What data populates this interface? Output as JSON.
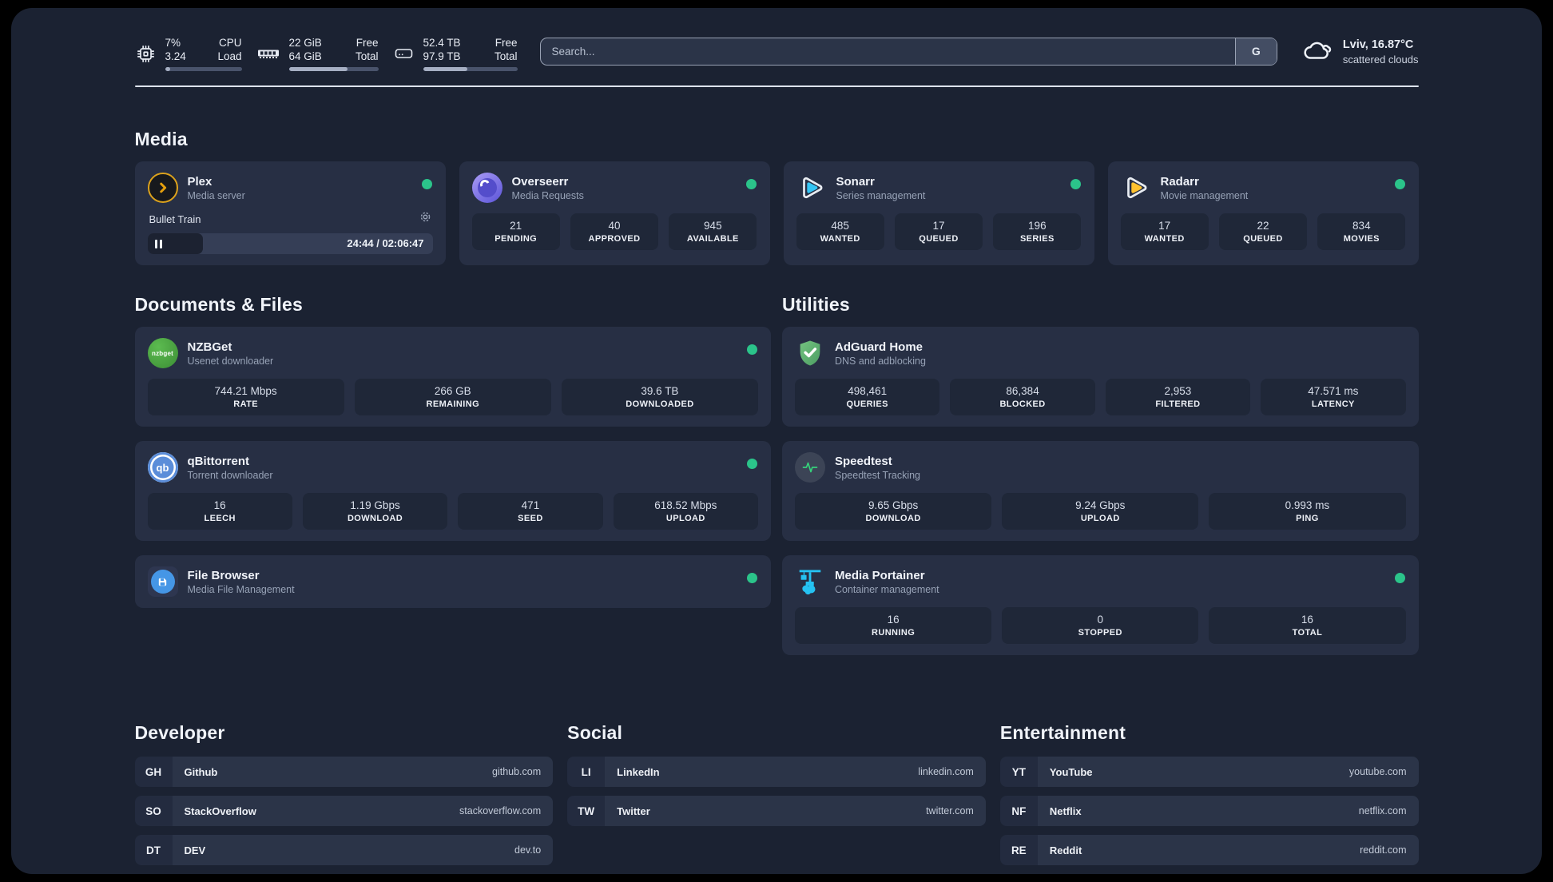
{
  "colors": {
    "status_online": "#2bc48a",
    "plex_gold": "#e5a00d",
    "overseerr_purple": "#6d64e8",
    "sonarr_cyan": "#35c5f4",
    "radarr_amber": "#ffc230",
    "nzbget_green": "#43a047",
    "qbittorrent_blue": "#5b8dd9",
    "filebrowser_blue": "#4596e6",
    "adguard_green": "#5fae6e",
    "speedtest_green": "#36d27b",
    "portainer_cyan": "#25c2f2"
  },
  "header": {
    "cpu": {
      "value1": "7%",
      "label1": "CPU",
      "value2": "3.24",
      "label2": "Load",
      "progress_pct": 7
    },
    "memory": {
      "value1": "22 GiB",
      "label1": "Free",
      "value2": "64 GiB",
      "label2": "Total",
      "progress_pct": 66
    },
    "disk": {
      "value1": "52.4 TB",
      "label1": "Free",
      "value2": "97.9 TB",
      "label2": "Total",
      "progress_pct": 47
    },
    "search": {
      "placeholder": "Search...",
      "button": "G"
    },
    "weather": {
      "line1": "Lviv, 16.87°C",
      "line2": "scattered clouds"
    }
  },
  "media": {
    "title": "Media",
    "plex": {
      "name": "Plex",
      "description": "Media server",
      "now_playing": "Bullet Train",
      "time_display": "24:44 / 02:06:47",
      "progress_pct": 19.5
    },
    "overseerr": {
      "name": "Overseerr",
      "description": "Media Requests",
      "stats": [
        {
          "value": "21",
          "label": "PENDING"
        },
        {
          "value": "40",
          "label": "APPROVED"
        },
        {
          "value": "945",
          "label": "AVAILABLE"
        }
      ]
    },
    "sonarr": {
      "name": "Sonarr",
      "description": "Series management",
      "stats": [
        {
          "value": "485",
          "label": "WANTED"
        },
        {
          "value": "17",
          "label": "QUEUED"
        },
        {
          "value": "196",
          "label": "SERIES"
        }
      ]
    },
    "radarr": {
      "name": "Radarr",
      "description": "Movie management",
      "stats": [
        {
          "value": "17",
          "label": "WANTED"
        },
        {
          "value": "22",
          "label": "QUEUED"
        },
        {
          "value": "834",
          "label": "MOVIES"
        }
      ]
    }
  },
  "documents": {
    "title": "Documents & Files",
    "nzbget": {
      "name": "NZBGet",
      "description": "Usenet downloader",
      "icon_text": "nzbget",
      "stats": [
        {
          "value": "744.21 Mbps",
          "label": "RATE"
        },
        {
          "value": "266 GB",
          "label": "REMAINING"
        },
        {
          "value": "39.6 TB",
          "label": "DOWNLOADED"
        }
      ]
    },
    "qbittorrent": {
      "name": "qBittorrent",
      "description": "Torrent downloader",
      "icon_text": "qb",
      "stats": [
        {
          "value": "16",
          "label": "LEECH"
        },
        {
          "value": "1.19 Gbps",
          "label": "DOWNLOAD"
        },
        {
          "value": "471",
          "label": "SEED"
        },
        {
          "value": "618.52 Mbps",
          "label": "UPLOAD"
        }
      ]
    },
    "filebrowser": {
      "name": "File Browser",
      "description": "Media File Management"
    }
  },
  "utilities": {
    "title": "Utilities",
    "adguard": {
      "name": "AdGuard Home",
      "description": "DNS and adblocking",
      "stats": [
        {
          "value": "498,461",
          "label": "QUERIES"
        },
        {
          "value": "86,384",
          "label": "BLOCKED"
        },
        {
          "value": "2,953",
          "label": "FILTERED"
        },
        {
          "value": "47.571 ms",
          "label": "LATENCY"
        }
      ]
    },
    "speedtest": {
      "name": "Speedtest",
      "description": "Speedtest Tracking",
      "stats": [
        {
          "value": "9.65 Gbps",
          "label": "DOWNLOAD"
        },
        {
          "value": "9.24 Gbps",
          "label": "UPLOAD"
        },
        {
          "value": "0.993 ms",
          "label": "PING"
        }
      ]
    },
    "portainer": {
      "name": "Media Portainer",
      "description": "Container management",
      "stats": [
        {
          "value": "16",
          "label": "RUNNING"
        },
        {
          "value": "0",
          "label": "STOPPED"
        },
        {
          "value": "16",
          "label": "TOTAL"
        }
      ]
    }
  },
  "bookmarks": {
    "developer": {
      "title": "Developer",
      "links": [
        {
          "badge": "GH",
          "name": "Github",
          "url": "github.com"
        },
        {
          "badge": "SO",
          "name": "StackOverflow",
          "url": "stackoverflow.com"
        },
        {
          "badge": "DT",
          "name": "DEV",
          "url": "dev.to"
        }
      ]
    },
    "social": {
      "title": "Social",
      "links": [
        {
          "badge": "LI",
          "name": "LinkedIn",
          "url": "linkedin.com"
        },
        {
          "badge": "TW",
          "name": "Twitter",
          "url": "twitter.com"
        }
      ]
    },
    "entertainment": {
      "title": "Entertainment",
      "links": [
        {
          "badge": "YT",
          "name": "YouTube",
          "url": "youtube.com"
        },
        {
          "badge": "NF",
          "name": "Netflix",
          "url": "netflix.com"
        },
        {
          "badge": "RE",
          "name": "Reddit",
          "url": "reddit.com"
        }
      ]
    }
  }
}
